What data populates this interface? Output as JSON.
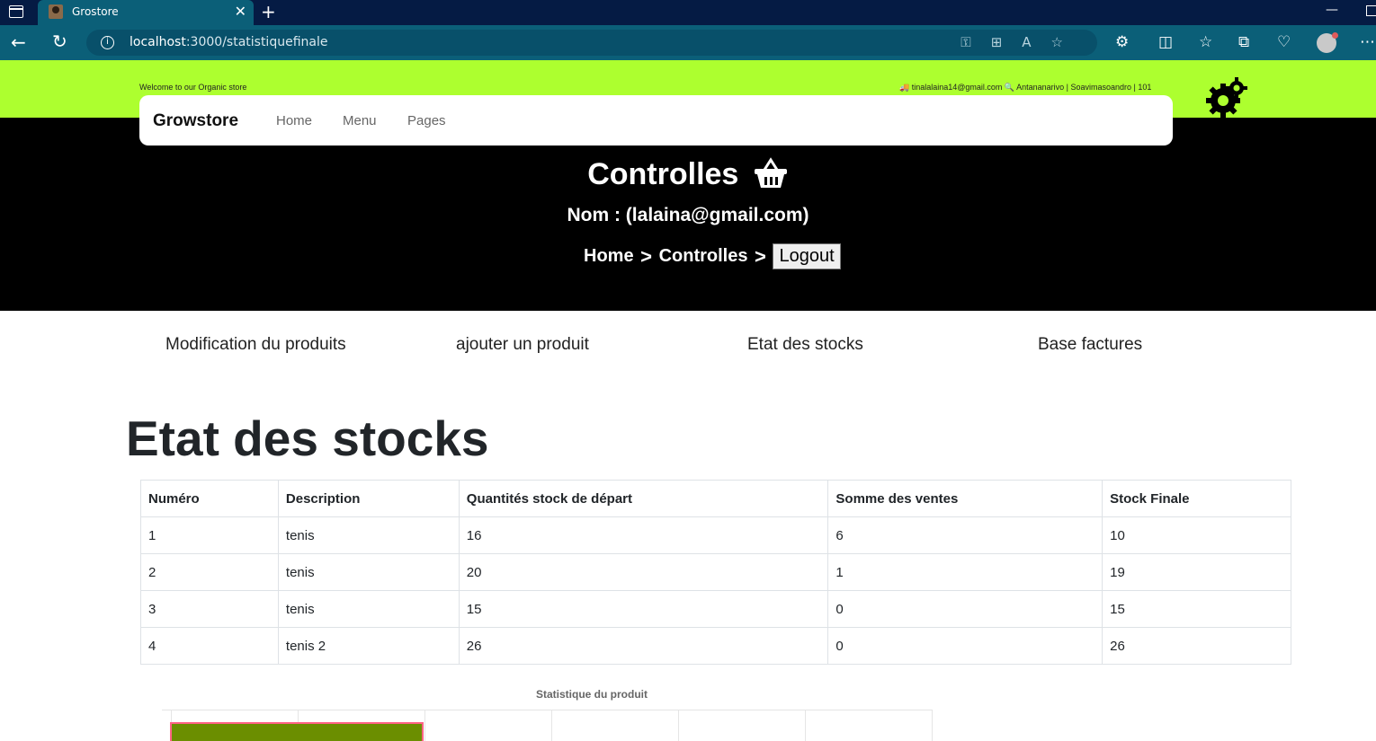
{
  "browser": {
    "tab_title": "Grostore",
    "url_host": "localhost",
    "url_path": ":3000/statistiquefinale"
  },
  "topbar": {
    "welcome": "Welcome to our Organic store",
    "contact": "🚚 tinalalaina14@gmail.com 🔍 Antananarivo | Soavimasoandro | 101"
  },
  "navbar": {
    "brand": "Growstore",
    "links": [
      "Home",
      "Menu",
      "Pages"
    ]
  },
  "hero": {
    "title": "Controlles",
    "subtitle": "Nom : (lalaina@gmail.com)",
    "breadcrumb": [
      "Home",
      "Controlles"
    ],
    "logout_label": "Logout"
  },
  "section_nav": [
    "Modification du produits",
    "ajouter un produit",
    "Etat des stocks",
    "Base factures"
  ],
  "page_heading": "Etat des stocks",
  "table": {
    "headers": [
      "Numéro",
      "Description",
      "Quantités stock de départ",
      "Somme des ventes",
      "Stock Finale"
    ],
    "rows": [
      [
        "1",
        "tenis",
        "16",
        "6",
        "10"
      ],
      [
        "2",
        "tenis",
        "20",
        "1",
        "19"
      ],
      [
        "3",
        "tenis",
        "15",
        "0",
        "15"
      ],
      [
        "4",
        "tenis 2",
        "26",
        "0",
        "26"
      ]
    ]
  },
  "chart_data": {
    "type": "bar",
    "title": "Statistique du produit",
    "bar_color": "#6b8e00",
    "bar_border": "#ff6384"
  }
}
